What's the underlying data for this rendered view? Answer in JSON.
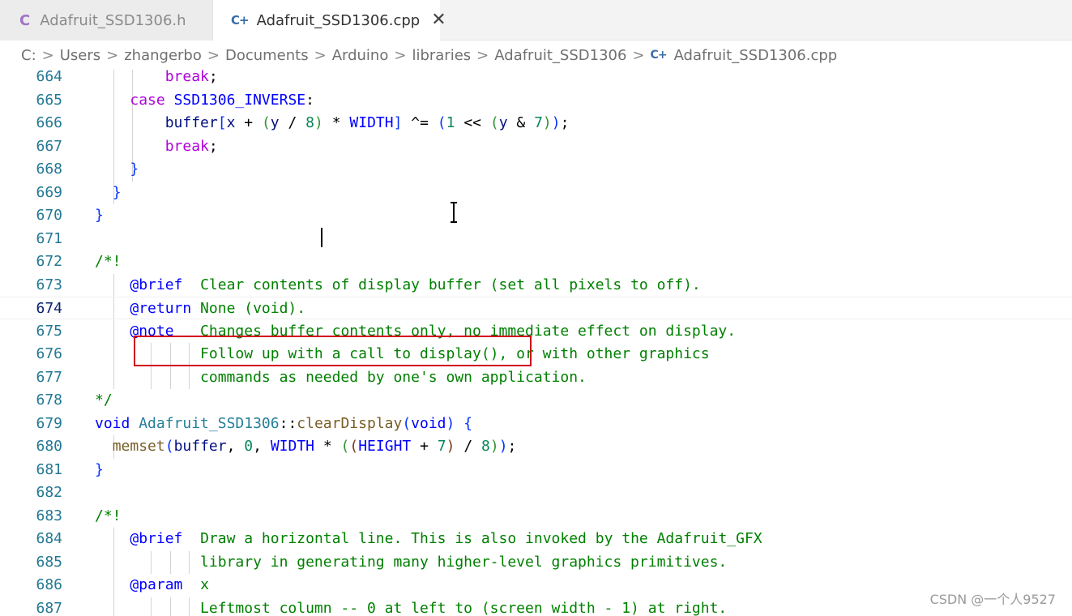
{
  "tabs": [
    {
      "icon": "C",
      "label": "Adafruit_SSD1306.h"
    },
    {
      "icon": "C+",
      "label": "Adafruit_SSD1306.cpp",
      "close": "✕"
    }
  ],
  "breadcrumb": {
    "separator": ">",
    "items": [
      "C:",
      "Users",
      "zhangerbo",
      "Documents",
      "Arduino",
      "libraries",
      "Adafruit_SSD1306"
    ],
    "file_icon": "C+",
    "file": "Adafruit_SSD1306.cpp"
  },
  "editor": {
    "current_line": "674",
    "lines": [
      {
        "n": "664",
        "text": "        break;"
      },
      {
        "n": "665",
        "text": "    case SSD1306_INVERSE:"
      },
      {
        "n": "666",
        "text": "        buffer[x + (y / 8) * WIDTH] ^= (1 << (y & 7));"
      },
      {
        "n": "667",
        "text": "        break;"
      },
      {
        "n": "668",
        "text": "    }"
      },
      {
        "n": "669",
        "text": "  }"
      },
      {
        "n": "670",
        "text": "}"
      },
      {
        "n": "671",
        "text": ""
      },
      {
        "n": "672",
        "text": "/*!"
      },
      {
        "n": "673",
        "text": "    @brief  Clear contents of display buffer (set all pixels to off)."
      },
      {
        "n": "674",
        "text": "    @return None (void)."
      },
      {
        "n": "675",
        "text": "    @note   Changes buffer contents only, no immediate effect on display."
      },
      {
        "n": "676",
        "text": "            Follow up with a call to display(), or with other graphics"
      },
      {
        "n": "677",
        "text": "            commands as needed by one's own application."
      },
      {
        "n": "678",
        "text": "*/"
      },
      {
        "n": "679",
        "text": "void Adafruit_SSD1306::clearDisplay(void) {"
      },
      {
        "n": "680",
        "text": "  memset(buffer, 0, WIDTH * ((HEIGHT + 7) / 8));"
      },
      {
        "n": "681",
        "text": "}"
      },
      {
        "n": "682",
        "text": ""
      },
      {
        "n": "683",
        "text": "/*!"
      },
      {
        "n": "684",
        "text": "    @brief  Draw a horizontal line. This is also invoked by the Adafruit_GFX"
      },
      {
        "n": "685",
        "text": "            library in generating many higher-level graphics primitives."
      },
      {
        "n": "686",
        "text": "    @param  x"
      },
      {
        "n": "687",
        "text": "            Leftmost column -- 0 at left to (screen width - 1) at right."
      }
    ]
  },
  "watermark": "CSDN @一个人9527",
  "colors": {
    "keyword": "#af00db",
    "type": "#0000ff",
    "namespace": "#267f99",
    "function": "#795e26",
    "variable": "#001080",
    "number": "#098658",
    "comment": "#008000",
    "doc_tag": "#0000ff",
    "line_number": "#237893",
    "highlight_box": "#d0021b"
  },
  "icons": {
    "tab_h": "c-file-icon",
    "tab_cpp": "cpp-file-icon",
    "close": "close-icon",
    "cursor": "text-cursor-icon"
  }
}
